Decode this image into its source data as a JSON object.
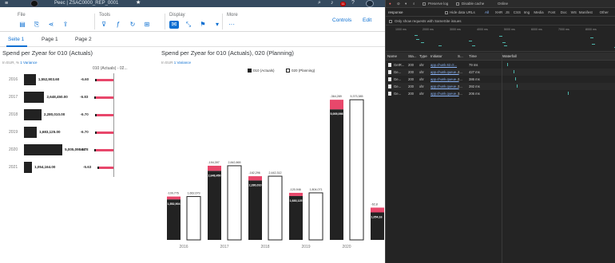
{
  "shell": {
    "menu_icon": "hamburger-menu-icon",
    "title": "Peec  |  ZSAC0000_REP_0001",
    "notification_count": "11"
  },
  "toolbar": {
    "file_label": "File",
    "tools_label": "Tools",
    "display_label": "Display",
    "more_label": "More",
    "controls_label": "Controls",
    "edit_label": "Edit"
  },
  "tabs": [
    {
      "label": "Seite 1",
      "active": true
    },
    {
      "label": "Page 1",
      "active": false
    },
    {
      "label": "Page 2",
      "active": false
    }
  ],
  "left_chart": {
    "title": "Spend per Zyear for 010 (Actuals)",
    "unit": "In EUR, %",
    "variance_label": "1 Variance",
    "variance_header": "010 (Actuals) - 02..."
  },
  "right_chart": {
    "title": "Spend per Zyear for 010 (Actuals), 020 (Planning)",
    "unit": "In EUR",
    "variance_label": "1 Variance",
    "legend_actuals": "010 (Actuals)",
    "legend_planning": "020 (Planning)"
  },
  "chart_data": [
    {
      "type": "bar",
      "orientation": "horizontal",
      "title": "Spend per Zyear for 010 (Actuals)",
      "categories": [
        "2016",
        "2017",
        "2018",
        "2019",
        "2020",
        "2021"
      ],
      "series": [
        {
          "name": "010 (Actuals)",
          "values": [
            1552903.6,
            2648450.0,
            2280010.0,
            1683125.0,
            5005098.0,
            1054164.0
          ],
          "labels": [
            "1,552,903.60",
            "2,648,450.00",
            "2,280,010.00",
            "1,683,125.00",
            "5,005,098.00",
            "1,054,164.00"
          ]
        }
      ],
      "variance": {
        "name": "010 (Actuals) - 02...",
        "values": [
          -6.6,
          -6.83,
          -6.7,
          -6.7,
          -6.78,
          -5.63
        ],
        "labels": [
          "-6.60",
          "-6.83",
          "-6.70",
          "-6.70",
          "-6.78",
          "-5.63"
        ]
      },
      "ylim": [
        0,
        5200000
      ]
    },
    {
      "type": "bar",
      "title": "Spend per Zyear for 010 (Actuals), 020 (Planning)",
      "categories": [
        "2016",
        "2017",
        "2018",
        "2019",
        "2020",
        ""
      ],
      "series": [
        {
          "name": "010 (Actuals)",
          "values": [
            1552904,
            2648450,
            2280010,
            1683125,
            5005098,
            1054164
          ],
          "labels": [
            "1,552,904",
            "2,648,450",
            "2,280,010",
            "1,683,125",
            "5,005,098",
            "1,054,16"
          ]
        },
        {
          "name": "020 (Planning)",
          "values": [
            1662679,
            2842865,
            2442312,
            1804071,
            5373385,
            0
          ],
          "labels": [
            "1,662,679",
            "2,842,865",
            "2,442,312",
            "1,804,071",
            "5,373,385",
            ""
          ]
        }
      ],
      "variance_labels": [
        "-109,776",
        "-194,397",
        "-162,296",
        "-120,946",
        "-364,289",
        "-62,8"
      ],
      "ylim": [
        0,
        5500000
      ],
      "legend": "top-center"
    }
  ],
  "devtools": {
    "filter_placeholder": "response",
    "options": [
      "Preserve log",
      "Disable cache",
      "Online"
    ],
    "hide_data_urls": "Hide data URLs",
    "filter_types": [
      "All",
      "XHR",
      "JS",
      "CSS",
      "Img",
      "Media",
      "Font",
      "Doc",
      "WS",
      "Manifest",
      "Other"
    ],
    "samesite": "Only show requests with SameSite issues",
    "timeline_ticks": [
      "1000 ms",
      "2000 ms",
      "3000 ms",
      "4000 ms",
      "5000 ms",
      "6000 ms",
      "7000 ms",
      "8000 ms"
    ],
    "columns": [
      "Name",
      "Sta...",
      "Type",
      "Initiator",
      "S...",
      "Time",
      "Waterfall"
    ],
    "rows": [
      {
        "name": "GetR...",
        "status": "200",
        "type": "xhr",
        "initiator": "app.chunk.62.ct...",
        "size": "",
        "time": "79 ms"
      },
      {
        "name": "Ge...",
        "status": "200",
        "type": "xhr",
        "initiator": "app.chunk.queue...",
        "size": "2...",
        "time": "427 ms"
      },
      {
        "name": "Ge...",
        "status": "200",
        "type": "xhr",
        "initiator": "app.chunk.queue...",
        "size": "2...",
        "time": "386 ms"
      },
      {
        "name": "Ge...",
        "status": "200",
        "type": "xhr",
        "initiator": "app.chunk.queue...",
        "size": "2...",
        "time": "392 ms"
      },
      {
        "name": "Ge...",
        "status": "200",
        "type": "xhr",
        "initiator": "app.chunk.queue...",
        "size": "3...",
        "time": "206 ms"
      }
    ]
  }
}
